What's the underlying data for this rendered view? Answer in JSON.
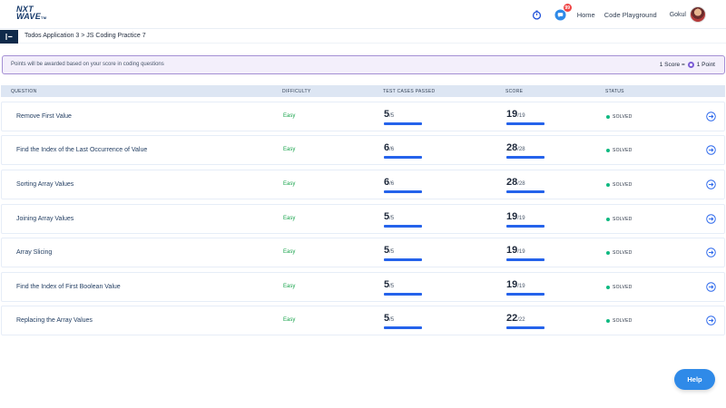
{
  "brand": {
    "line1": "NXT",
    "line2": "WAVE",
    "tm": "TM"
  },
  "nav": {
    "notification_count": "99",
    "links": [
      "Home",
      "Code Playground"
    ],
    "user_name": "Gokul"
  },
  "breadcrumb": {
    "text": "Todos Application 3 > JS Coding Practice 7"
  },
  "banner": {
    "text": "Points will be awarded based on your score in coding questions",
    "score_left": "1 Score =",
    "score_right": "1 Point"
  },
  "table": {
    "headers": [
      "QUESTION",
      "DIFFICULTY",
      "TEST CASES PASSED",
      "SCORE",
      "STATUS"
    ],
    "rows": [
      {
        "title": "Remove First Value",
        "difficulty": "Easy",
        "passed": "5",
        "total": "/5",
        "score": "19",
        "max": "/19",
        "status": "SOLVED"
      },
      {
        "title": "Find the Index of the Last Occurrence of Value",
        "difficulty": "Easy",
        "passed": "6",
        "total": "/6",
        "score": "28",
        "max": "/28",
        "status": "SOLVED"
      },
      {
        "title": "Sorting Array Values",
        "difficulty": "Easy",
        "passed": "6",
        "total": "/6",
        "score": "28",
        "max": "/28",
        "status": "SOLVED"
      },
      {
        "title": "Joining Array Values",
        "difficulty": "Easy",
        "passed": "5",
        "total": "/5",
        "score": "19",
        "max": "/19",
        "status": "SOLVED"
      },
      {
        "title": "Array Slicing",
        "difficulty": "Easy",
        "passed": "5",
        "total": "/5",
        "score": "19",
        "max": "/19",
        "status": "SOLVED"
      },
      {
        "title": "Find the Index of First Boolean Value",
        "difficulty": "Easy",
        "passed": "5",
        "total": "/5",
        "score": "19",
        "max": "/19",
        "status": "SOLVED"
      },
      {
        "title": "Replacing the Array Values",
        "difficulty": "Easy",
        "passed": "5",
        "total": "/5",
        "score": "22",
        "max": "/22",
        "status": "SOLVED"
      }
    ]
  },
  "help": {
    "label": "Help"
  },
  "colors": {
    "accent": "#2563eb",
    "success": "#16a34a",
    "banner_border": "#a48fd4",
    "sidebar_toggle": "#0f2a4a"
  }
}
